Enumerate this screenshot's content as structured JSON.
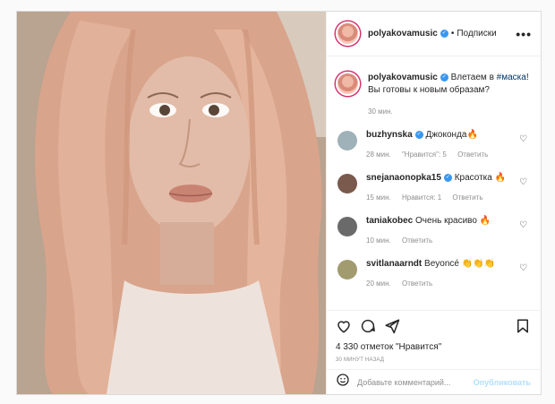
{
  "post": {
    "author": "polyakovamusic",
    "follow_label": "Подписки",
    "more_label": "•••",
    "caption_text": "Влетаем в",
    "caption_hashtag": "#маска",
    "caption_rest": "! Вы готовы к новым образам?",
    "caption_time": "30 мин."
  },
  "comments": [
    {
      "user": "buzhynska",
      "verified": true,
      "text": "Джоконда🔥",
      "time": "28 мин.",
      "likes": "\"Нравится\": 5",
      "reply": "Ответить",
      "avatar_color": "#9fb1b9"
    },
    {
      "user": "snejanaonopka15",
      "verified": true,
      "text": "Красотка 🔥",
      "time": "15 мин.",
      "likes": "Нравится: 1",
      "reply": "Ответить",
      "avatar_color": "#7a5a4c"
    },
    {
      "user": "taniakobec",
      "verified": false,
      "text": "Очень красиво 🔥",
      "time": "10 мин.",
      "likes": "",
      "reply": "Ответить",
      "avatar_color": "#6a6a6a"
    },
    {
      "user": "svitlanaarndt",
      "verified": false,
      "text": "Beyoncé 👏👏👏",
      "time": "20 мин.",
      "likes": "",
      "reply": "Ответить",
      "avatar_color": "#a29b6f"
    }
  ],
  "actions": {
    "likes_text": "4 330 отметок \"Нравится\"",
    "date_text": "30 МИНУТ НАЗАД",
    "comment_placeholder": "Добавьте комментарий...",
    "publish_label": "Опубликовать"
  },
  "icons": [
    "heart-icon",
    "comment-icon",
    "share-icon",
    "bookmark-icon",
    "emoji-icon",
    "more-icon",
    "verified-icon"
  ]
}
